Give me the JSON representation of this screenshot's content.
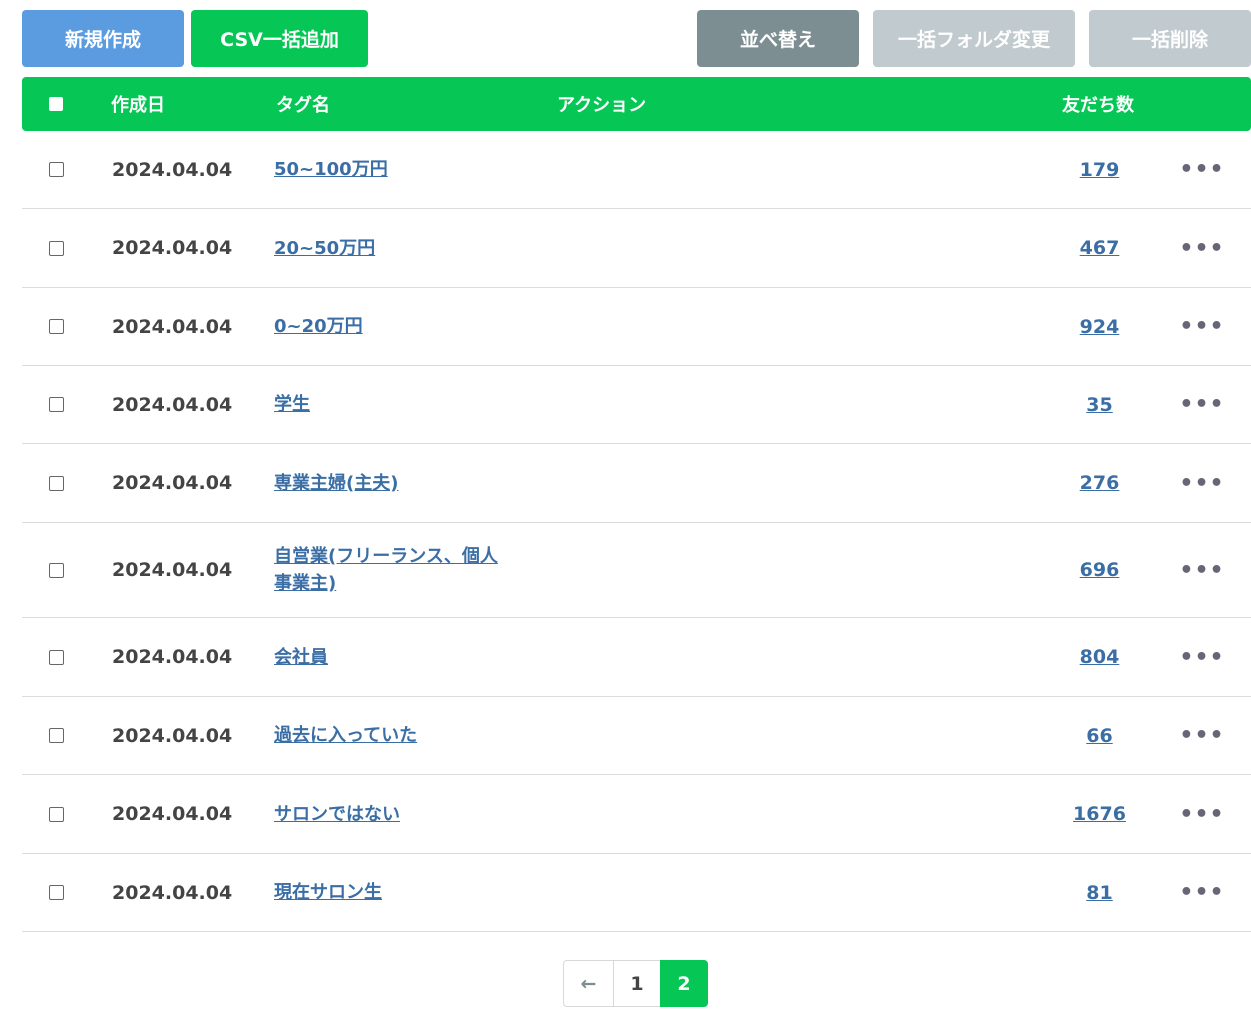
{
  "toolbar": {
    "new_label": "新規作成",
    "csv_label": "CSV一括追加",
    "sort_label": "並べ替え",
    "folder_label": "一括フォルダ変更",
    "delete_label": "一括削除"
  },
  "table": {
    "headers": {
      "created": "作成日",
      "tag": "タグ名",
      "action": "アクション",
      "friends": "友だち数"
    },
    "rows": [
      {
        "date": "2024.04.04",
        "tag": "50~100万円",
        "count": "179"
      },
      {
        "date": "2024.04.04",
        "tag": "20~50万円",
        "count": "467"
      },
      {
        "date": "2024.04.04",
        "tag": "0~20万円",
        "count": "924"
      },
      {
        "date": "2024.04.04",
        "tag": "学生",
        "count": "35"
      },
      {
        "date": "2024.04.04",
        "tag": "専業主婦(主夫)",
        "count": "276"
      },
      {
        "date": "2024.04.04",
        "tag": "自営業(フリーランス、個人事業主)",
        "count": "696"
      },
      {
        "date": "2024.04.04",
        "tag": "会社員",
        "count": "804"
      },
      {
        "date": "2024.04.04",
        "tag": "過去に入っていた",
        "count": "66"
      },
      {
        "date": "2024.04.04",
        "tag": "サロンではない",
        "count": "1676"
      },
      {
        "date": "2024.04.04",
        "tag": "現在サロン生",
        "count": "81"
      }
    ],
    "more_glyph": "•••"
  },
  "pagination": {
    "prev_glyph": "←",
    "pages": [
      "1",
      "2"
    ],
    "current": "2"
  },
  "colors": {
    "primary_green": "#06c755",
    "blue_button": "#5b9be0",
    "gray_button": "#7d8e93",
    "disabled_button": "#c0cacf",
    "link": "#3a6ea5"
  }
}
